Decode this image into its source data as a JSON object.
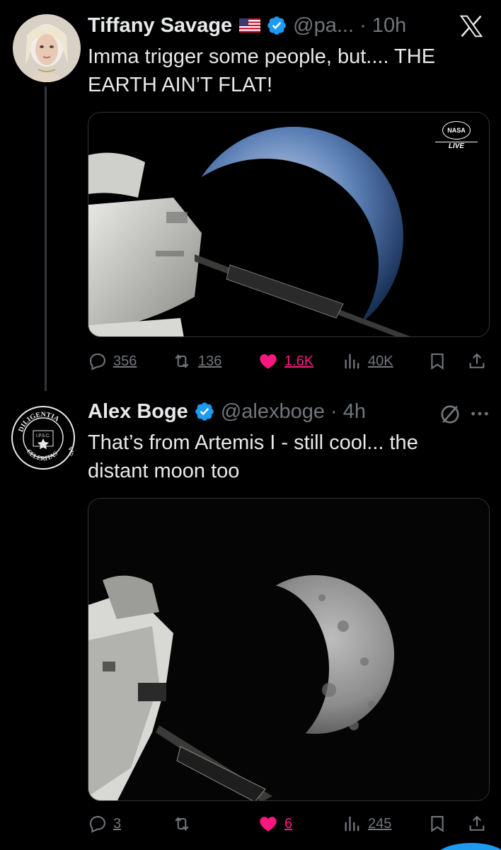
{
  "tweets": [
    {
      "author": "Tiffany Savage",
      "flag_emoji": "🇺🇸",
      "handle_time": "@pa... · 10h",
      "text": "Imma trigger some people, but....  THE EARTH AIN’T FLAT!",
      "media_badge": {
        "logo": "NASA",
        "live": "LIVE"
      },
      "stats": {
        "replies": "356",
        "reposts": "136",
        "likes": "1.6K",
        "views": "40K"
      },
      "liked": true,
      "platform_icon": "x-logo-icon"
    },
    {
      "author": "Alex Boge",
      "handle_time": "@alexboge · 4h",
      "text": "That’s from Artemis I - still cool... the distant moon too",
      "avatar_seal": {
        "top": "DILIGENTIA",
        "right": "VIS",
        "bottom": "CELERITAS",
        "center": "I.P.S.C."
      },
      "stats": {
        "replies": "3",
        "reposts": "",
        "likes": "6",
        "views": "245"
      },
      "liked": true,
      "icons": [
        "grok-icon",
        "more-icon"
      ]
    }
  ],
  "colors": {
    "background": "#000000",
    "text": "#e7e9ea",
    "secondary": "#71767b",
    "like": "#f91880",
    "verified": "#1d9bf0"
  }
}
